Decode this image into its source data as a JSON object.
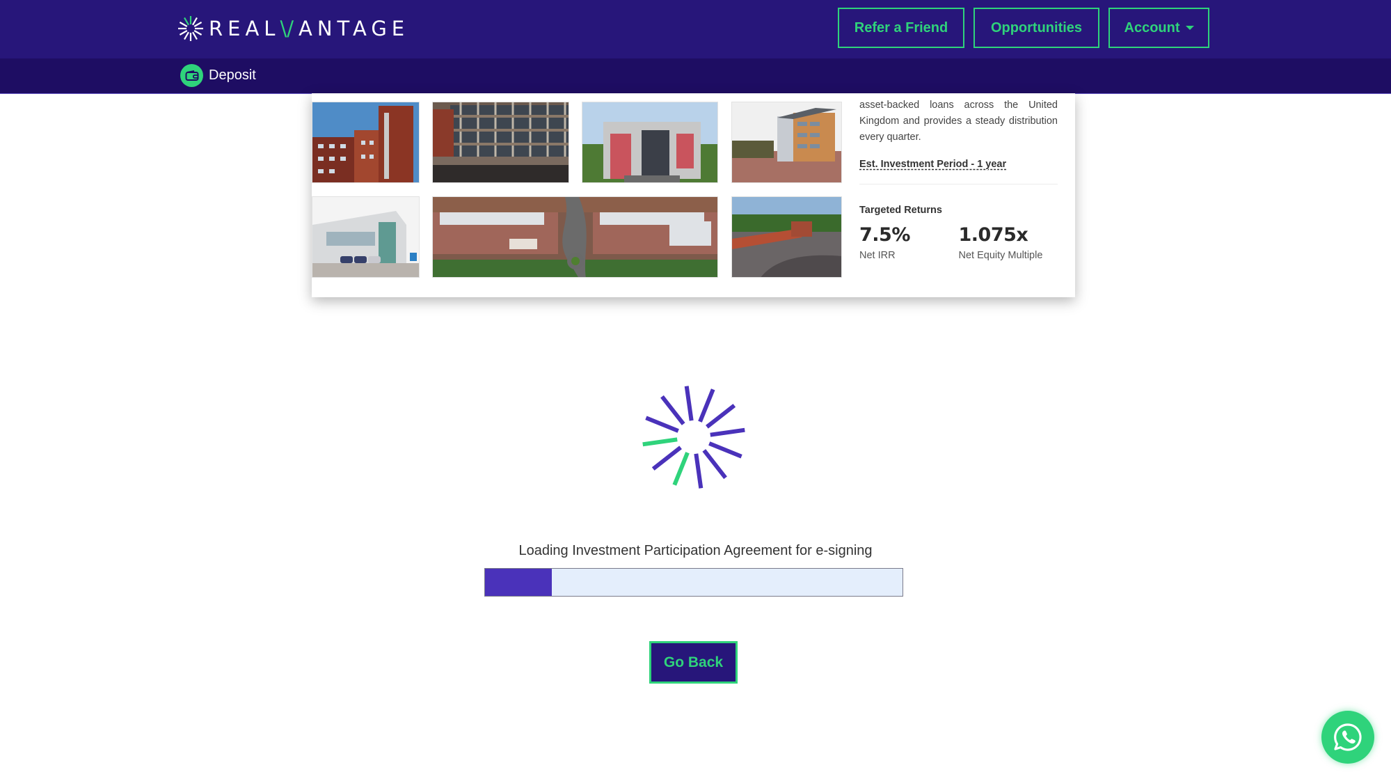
{
  "header": {
    "brand": {
      "prefix": "REAL",
      "v": "\\/",
      "suffix": "ANTAGE",
      "icon": "starburst-logo-icon"
    },
    "nav": [
      {
        "label": "Refer a Friend"
      },
      {
        "label": "Opportunities"
      },
      {
        "label": "Account",
        "icon": "caret-down-icon"
      }
    ],
    "colors": {
      "primary": "#27167a",
      "subbar": "#1e0d63",
      "accent": "#2fd37b"
    }
  },
  "subheader": {
    "deposit": {
      "label": "Deposit",
      "icon": "wallet-icon"
    }
  },
  "investment_card": {
    "photos": [
      {
        "alt": "red brick office building"
      },
      {
        "alt": "office tower facade"
      },
      {
        "alt": "red and grey office building"
      },
      {
        "alt": "modern office building with plaza"
      },
      {
        "alt": "glass office with parked cars"
      },
      {
        "alt": "aerial view of retail park"
      },
      {
        "alt": "retail park with roundabout"
      }
    ],
    "description": "asset-backed loans across the United Kingdom and provides a steady distribution every quarter.",
    "investment_period": "Est. Investment Period - 1 year",
    "returns_title": "Targeted Returns",
    "metrics": [
      {
        "value": "7.5%",
        "label": "Net IRR"
      },
      {
        "value": "1.075x",
        "label": "Net Equity Multiple"
      }
    ]
  },
  "loading": {
    "spinner_icon": "loading-spinner-icon",
    "message": "Loading Investment Participation Agreement for e-signing",
    "progress_percent": 16,
    "colors": {
      "fill": "#4a32ba",
      "track": "#e4eefc",
      "spinner_primary": "#4a32ba",
      "spinner_accent": "#2fd37b"
    }
  },
  "actions": {
    "go_back_label": "Go Back"
  },
  "chat_widget": {
    "icon": "whatsapp-icon"
  }
}
